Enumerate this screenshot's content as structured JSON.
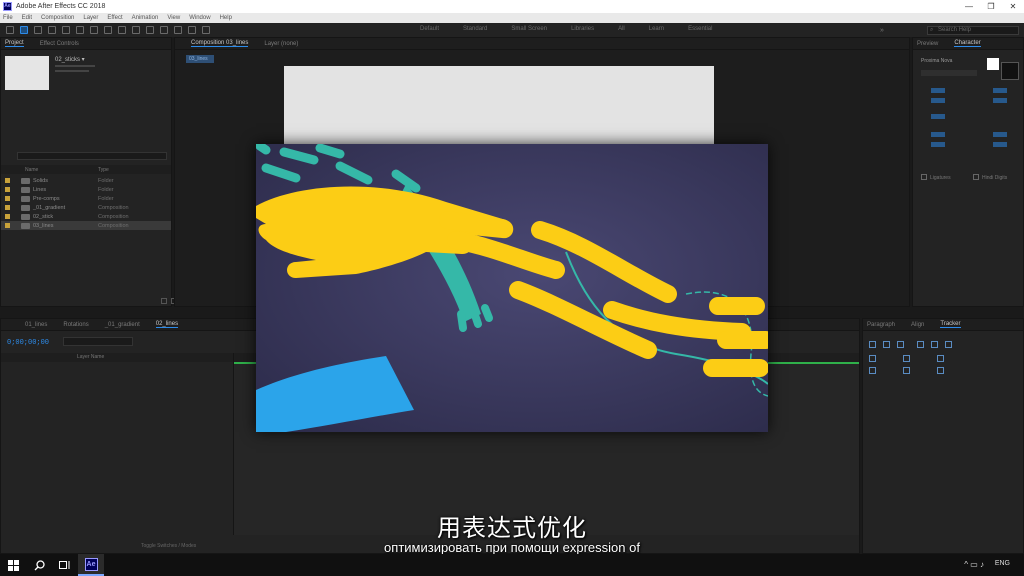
{
  "window": {
    "title": "Adobe After Effects CC 2018",
    "app_icon": "Ae",
    "controls": [
      "—",
      "❐",
      "✕"
    ]
  },
  "menu": [
    "File",
    "Edit",
    "Composition",
    "Layer",
    "Effect",
    "Animation",
    "View",
    "Window",
    "Help"
  ],
  "workspaces": [
    "Default",
    "Standard",
    "Small Screen",
    "Libraries",
    "All",
    "Learn",
    "Essential"
  ],
  "workspace_more": "»",
  "help_search_placeholder": "Search Help",
  "project_panel": {
    "tabs": [
      "Project",
      "Effect Controls"
    ],
    "item_name": "02_sticks ▾",
    "columns": [
      "Name",
      "Type"
    ],
    "rows": [
      {
        "name": "Solids",
        "type": "Folder"
      },
      {
        "name": "Lines",
        "type": "Folder"
      },
      {
        "name": "Pre-comps",
        "type": "Folder"
      },
      {
        "name": "_01_gradient",
        "type": "Composition"
      },
      {
        "name": "02_stick",
        "type": "Composition"
      },
      {
        "name": "03_lines",
        "type": "Composition"
      }
    ]
  },
  "composition_panel": {
    "tabs": [
      "Composition 03_lines",
      "Layer (none)"
    ],
    "active_chip": "03_lines"
  },
  "character_panel": {
    "tabs": [
      "Preview",
      "Character"
    ],
    "font": "Proxima Nova",
    "checkboxes": [
      "Ligatures",
      "Hindi Digits"
    ]
  },
  "timeline_panel": {
    "tabs": [
      "01_lines",
      "Rotations",
      "_01_gradient",
      "02_lines"
    ],
    "timecode": "0;00;00;00",
    "layer_header": "Layer Name",
    "bottom_label": "Toggle Switches / Modes"
  },
  "align_panel": {
    "tabs": [
      "Paragraph",
      "Align",
      "Tracker"
    ]
  },
  "subtitles": {
    "chinese": "用表达式优化",
    "russian": "оптимизировать при помощи expression of"
  },
  "taskbar": {
    "items": [
      "windows-start",
      "search",
      "task-view",
      "after-effects"
    ],
    "language": "ENG",
    "tray": "^ ▭ ♪"
  },
  "colors": {
    "accent_blue": "#2d8ceb",
    "timeline_green": "#2fb04a",
    "video_bg": "#3f3d63",
    "video_yellow": "#fccd15",
    "video_teal": "#35b8a8",
    "video_blue": "#2ba4ea"
  }
}
